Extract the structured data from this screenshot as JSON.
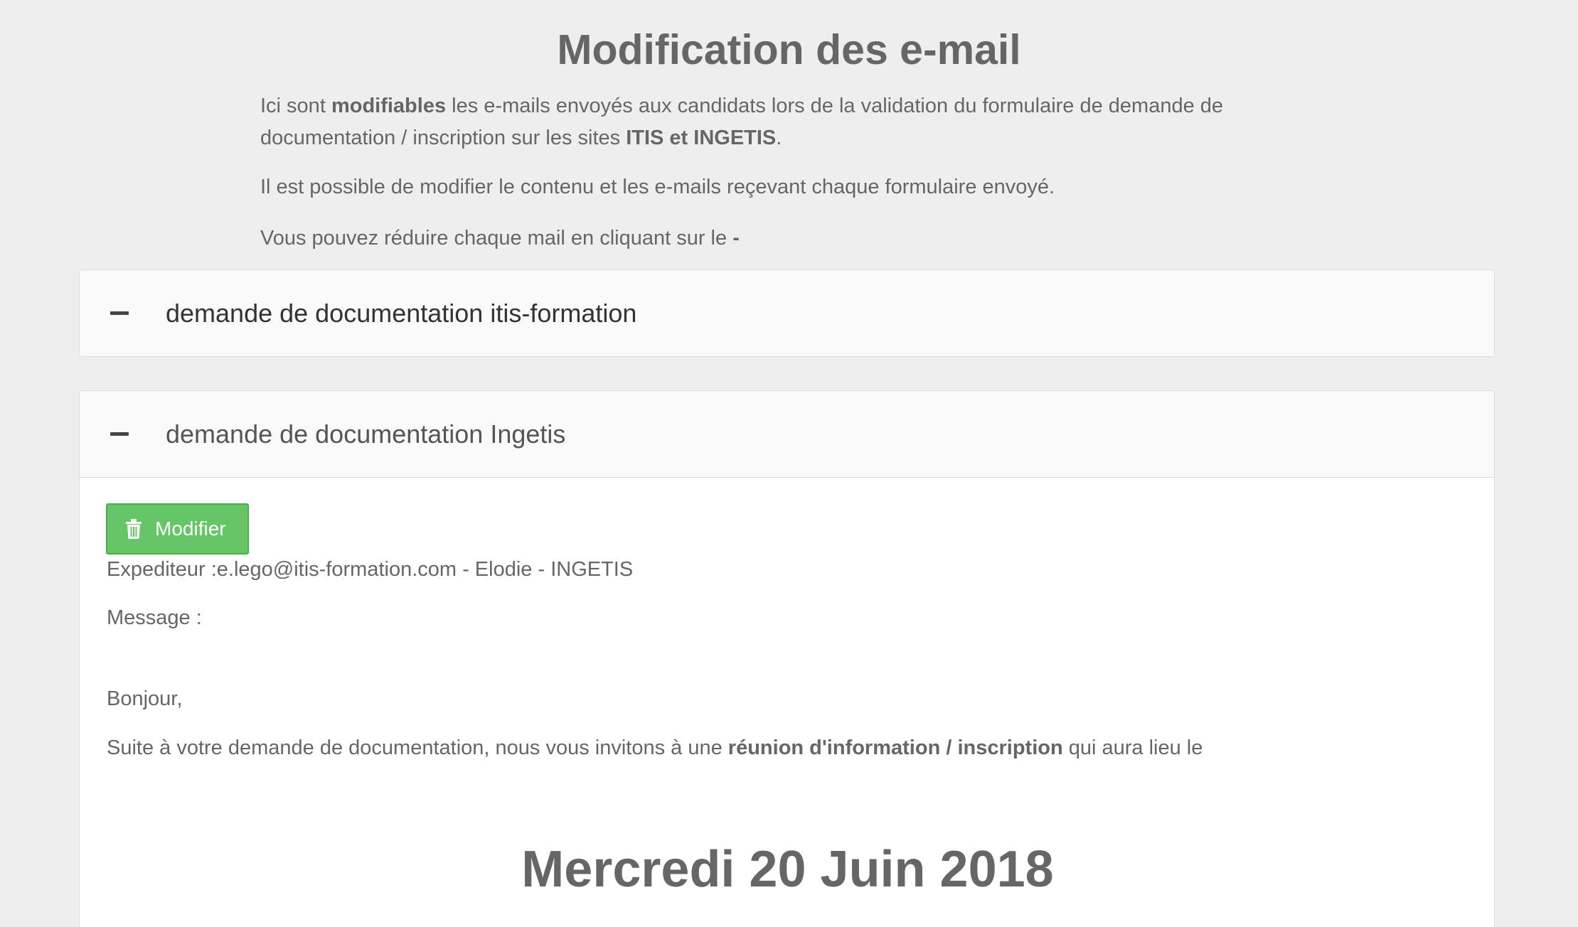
{
  "page": {
    "title": "Modification des e-mail"
  },
  "intro": {
    "p1_a": "Ici sont ",
    "p1_b": "modifiables",
    "p1_c": " les e-mails envoyés aux candidats lors de la validation du formulaire de demande de documentation / inscription sur les sites ",
    "p1_d": "ITIS et INGETIS",
    "p1_e": ".",
    "p2": "Il est possible de modifier le contenu et les e-mails reçevant chaque formulaire envoyé.",
    "p3_a": "Vous pouvez réduire chaque mail en cliquant sur le ",
    "p3_b": "-"
  },
  "panels": [
    {
      "title": "demande de documentation itis-formation",
      "icon": "minus-icon"
    },
    {
      "title": "demande de documentation Ingetis",
      "icon": "minus-icon",
      "button_label": "Modifier",
      "button_icon": "trash-icon",
      "button_color": "#66c566",
      "sender": "Expediteur :e.lego@itis-formation.com - Elodie - INGETIS",
      "message_label": "Message :",
      "greeting": "Bonjour,",
      "body_a": "Suite à votre demande de documentation, nous vous invitons à une ",
      "body_b": "réunion d'information / inscription",
      "body_c": " qui aura lieu le",
      "date": "Mercredi 20 Juin 2018"
    }
  ]
}
